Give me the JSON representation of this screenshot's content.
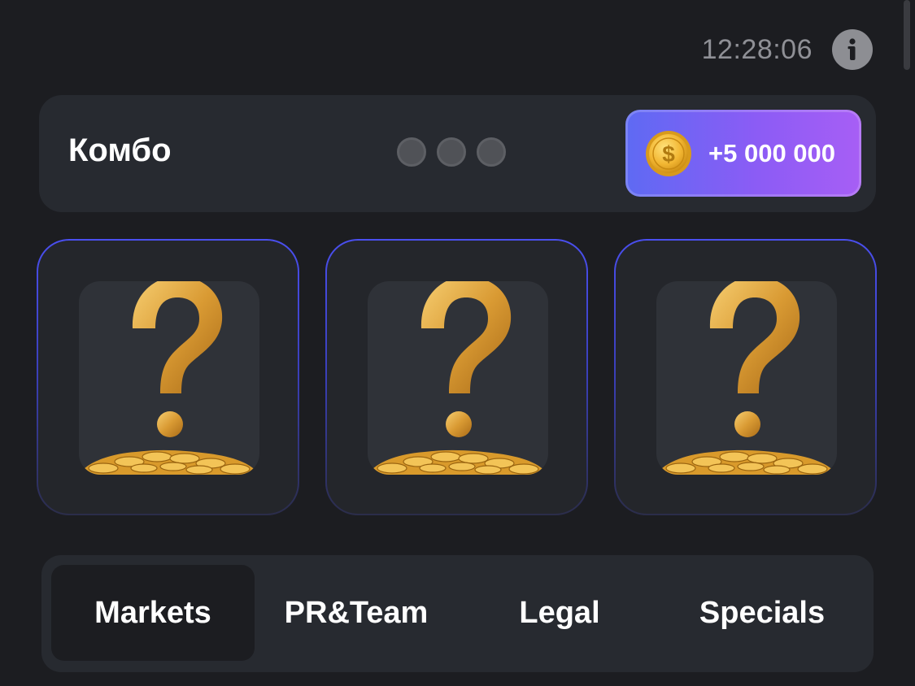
{
  "header": {
    "time": "12:28:06",
    "info_icon": "info-icon"
  },
  "combo": {
    "title": "Комбо",
    "progress_dots": 3,
    "reward_label": "+5 000 000",
    "reward_icon": "coin-icon"
  },
  "cards": [
    {
      "icon": "question-mark-coins-icon"
    },
    {
      "icon": "question-mark-coins-icon"
    },
    {
      "icon": "question-mark-coins-icon"
    }
  ],
  "tabs": [
    {
      "label": "Markets",
      "active": true
    },
    {
      "label": "PR&Team",
      "active": false
    },
    {
      "label": "Legal",
      "active": false
    },
    {
      "label": "Specials",
      "active": false
    }
  ],
  "colors": {
    "background": "#1c1d21",
    "panel": "#272a30",
    "accent_start": "#5e6af3",
    "accent_end": "#a75ef5",
    "card_border": "#4a4ff0",
    "gold": "#e0a53a"
  }
}
